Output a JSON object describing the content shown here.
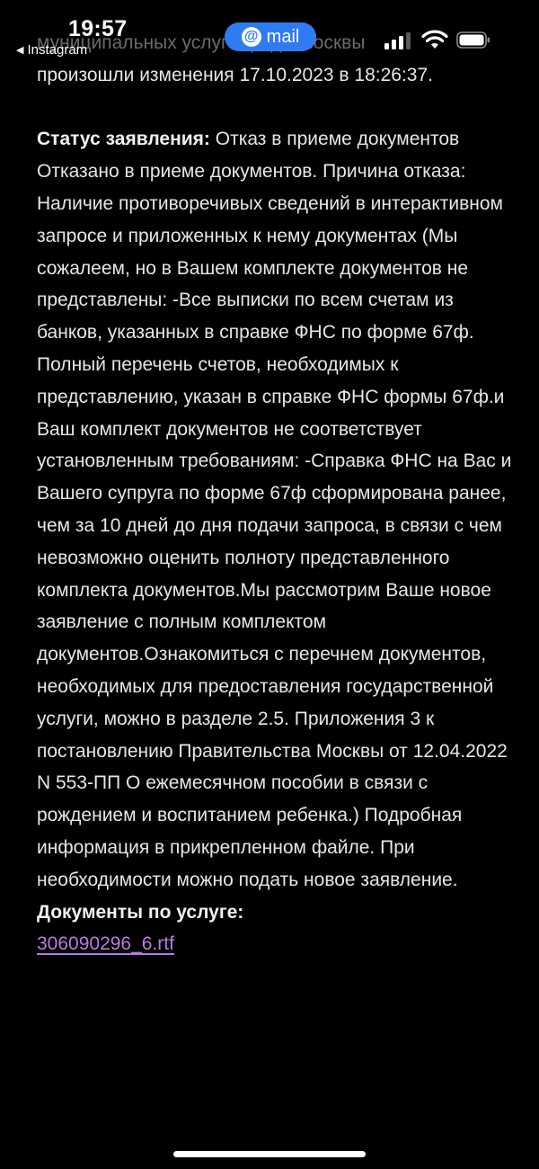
{
  "status_bar": {
    "time": "19:57",
    "back_app": "Instagram",
    "pill_label": "mail",
    "pill_symbol": "@"
  },
  "email": {
    "partial_line_top": "муниципальных услуг города Москвы",
    "intro_line": "произошли изменения 17.10.2023 в 18:26:37.",
    "status_label": "Статус заявления:",
    "status_value": " Отказ в приеме документов",
    "body_text": "Отказано в приеме документов. Причина отказа: Наличие противоречивых сведений в интерактивном запросе и приложенных к нему документах (Мы сожалеем, но в Вашем комплекте документов не представлены: -Все выписки по всем счетам из банков, указанных в справке ФНС по форме 67ф. Полный перечень счетов, необходимых к представлению, указан в справке ФНС формы 67ф.и Ваш комплект документов не соответствует установленным требованиям: -Справка ФНС на Вас и Вашего супруга по форме 67ф сформирована ранее, чем за 10 дней до дня подачи запроса, в связи с чем невозможно оценить полноту представленного комплекта документов.Мы рассмотрим Ваше новое заявление с полным комплектом документов.Ознакомиться с перечнем документов, необходимых для предоставления государственной услуги, можно в разделе 2.5. Приложения 3 к постановлению Правительства Москвы от 12.04.2022 N 553-ПП О ежемесячном пособии в связи с рождением и воспитанием ребенка.) Подробная информация в прикрепленном файле. При необходимости можно подать новое заявление.",
    "documents_label": "Документы по услуге:",
    "attachment_name": "306090296_6.rtf"
  },
  "colors": {
    "background": "#000000",
    "text": "#e6e6e6",
    "link": "#b77ce0",
    "pill": "#2f7bf2"
  }
}
